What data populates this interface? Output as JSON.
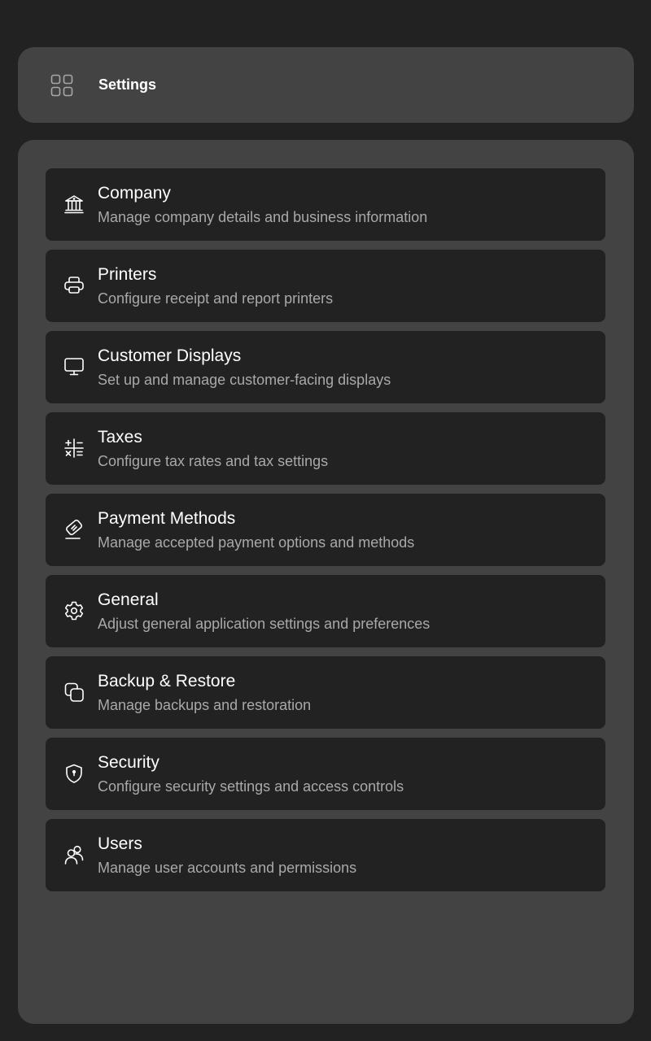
{
  "header": {
    "title": "Settings",
    "icon": "grid-icon"
  },
  "items": [
    {
      "title": "Company",
      "description": "Manage company details and business information",
      "icon": "bank-icon"
    },
    {
      "title": "Printers",
      "description": "Configure receipt and report printers",
      "icon": "printer-icon"
    },
    {
      "title": "Customer Displays",
      "description": "Set up and manage customer-facing displays",
      "icon": "monitor-icon"
    },
    {
      "title": "Taxes",
      "description": "Configure tax rates and tax settings",
      "icon": "calculator-icon"
    },
    {
      "title": "Payment Methods",
      "description": "Manage accepted payment options and methods",
      "icon": "payment-icon"
    },
    {
      "title": "General",
      "description": "Adjust general application settings and preferences",
      "icon": "gear-icon"
    },
    {
      "title": "Backup & Restore",
      "description": "Manage backups and restoration",
      "icon": "copy-icon"
    },
    {
      "title": "Security",
      "description": "Configure security settings and access controls",
      "icon": "shield-icon"
    },
    {
      "title": "Users",
      "description": "Manage user accounts and permissions",
      "icon": "users-icon"
    }
  ],
  "colors": {
    "background": "#222222",
    "card": "#434343",
    "item": "#222222",
    "text": "#ffffff",
    "subtext": "#a9a9a9"
  }
}
